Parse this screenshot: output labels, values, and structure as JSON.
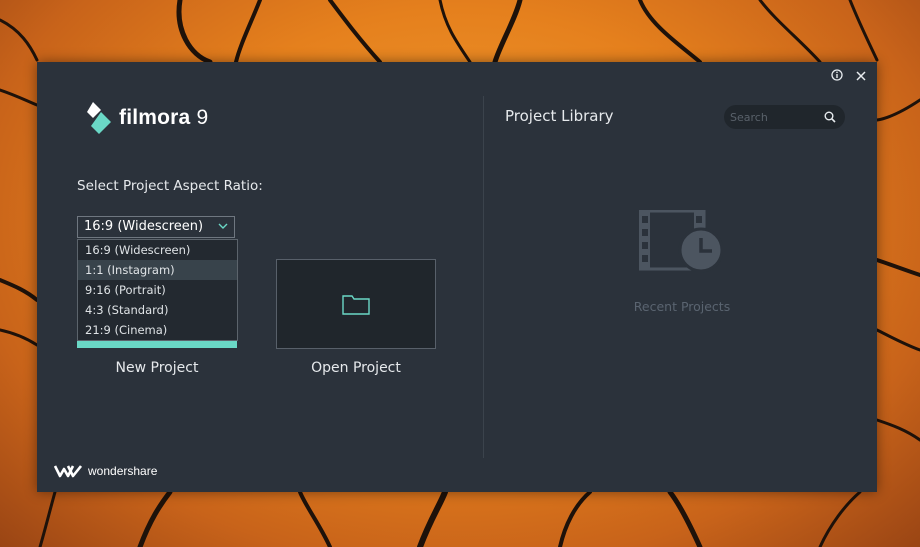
{
  "app": {
    "logo_text": "filmora",
    "logo_version": "9",
    "brand_footer": "wondershare"
  },
  "window_controls": {
    "info_icon": "info-circle-icon",
    "close_icon": "close-icon"
  },
  "new_project": {
    "aspect_label": "Select Project Aspect Ratio:",
    "selected_value": "16:9 (Widescreen)",
    "options": [
      "16:9 (Widescreen)",
      "1:1 (Instagram)",
      "9:16 (Portrait)",
      "4:3 (Standard)",
      "21:9 (Cinema)"
    ],
    "highlighted_option": "1:1 (Instagram)",
    "label": "New Project"
  },
  "open_project": {
    "label": "Open Project",
    "icon": "folder-icon"
  },
  "library": {
    "title": "Project Library",
    "search_placeholder": "Search",
    "empty_label": "Recent Projects",
    "empty_icon": "film-clock-icon"
  },
  "colors": {
    "accent": "#6ad8c6",
    "dialog_bg": "#2b323b",
    "desktop_bg": "#e5801d"
  }
}
